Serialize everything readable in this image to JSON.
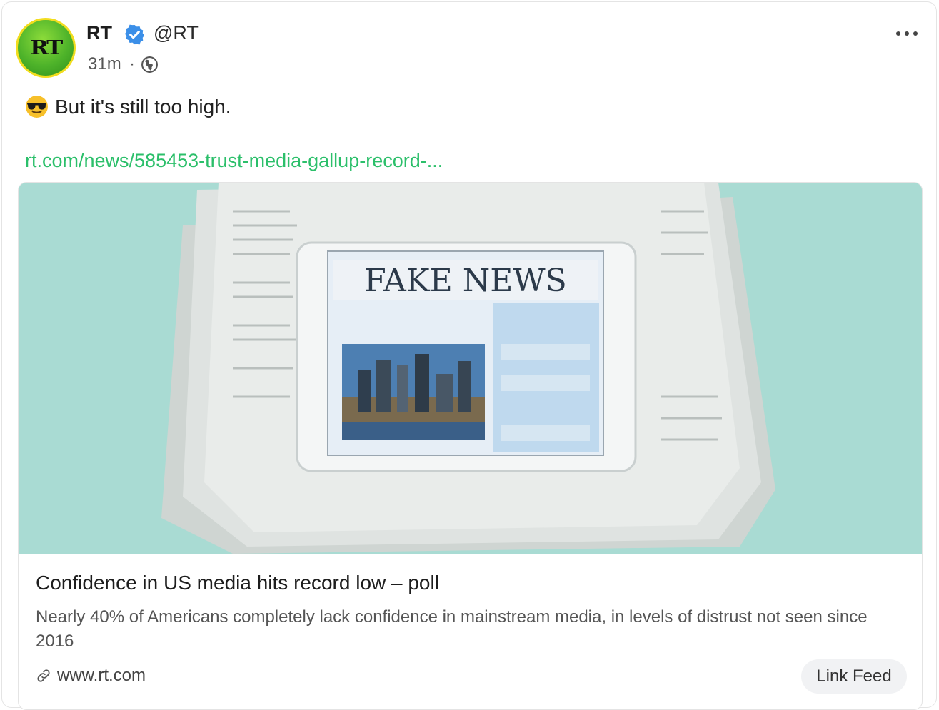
{
  "post": {
    "author_name": "RT",
    "handle": "@RT",
    "avatar_text": "RT",
    "time": "31m",
    "separator": "·",
    "visibility_icon": "globe-icon",
    "verified_icon": "verified-badge-icon",
    "more_icon": "more-options-icon",
    "emoji": "sunglasses-face-emoji",
    "text": "But it's still too high.",
    "link_text": "rt.com/news/585453-trust-media-gallup-record-..."
  },
  "card": {
    "image_caption_text": "FAKE NEWS",
    "title": "Confidence in US media hits record low – poll",
    "description": "Nearly 40% of Americans completely lack confidence in mainstream media, in levels of distrust not seen since 2016",
    "domain": "www.rt.com",
    "domain_icon": "link-icon",
    "button_label": "Link Feed"
  },
  "colors": {
    "link": "#2bbf6a",
    "verified": "#3b8fe8",
    "avatar_ring": "#f2dd1f",
    "avatar_fill": "#4eb32a",
    "image_bg": "#a9dbd3",
    "button_bg": "#f1f2f4"
  }
}
